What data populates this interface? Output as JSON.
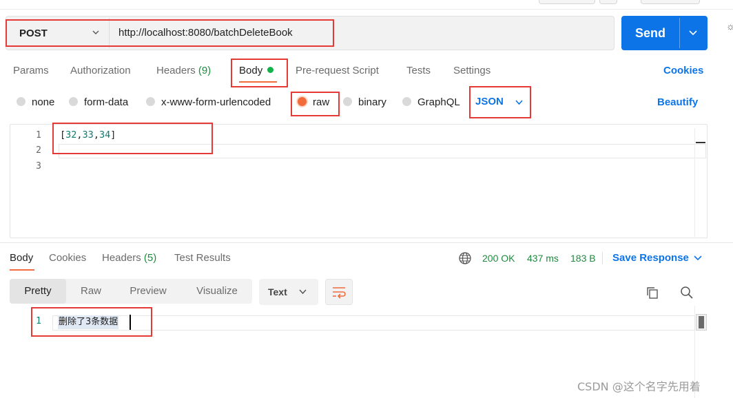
{
  "colors": {
    "accent": "#0d74e7",
    "active_underline": "#f26b3a",
    "highlight_box": "#e53935",
    "status_ok": "#1f8a3e"
  },
  "request": {
    "method": "POST",
    "url": "http://localhost:8080/batchDeleteBook",
    "send_label": "Send"
  },
  "request_tabs": [
    {
      "label": "Params"
    },
    {
      "label": "Authorization"
    },
    {
      "label": "Headers",
      "count": "(9)"
    },
    {
      "label": "Body"
    },
    {
      "label": "Pre-request Script"
    },
    {
      "label": "Tests"
    },
    {
      "label": "Settings"
    }
  ],
  "cookies_link": "Cookies",
  "body_types": [
    "none",
    "form-data",
    "x-www-form-urlencoded",
    "raw",
    "binary",
    "GraphQL"
  ],
  "body_format": "JSON",
  "beautify_label": "Beautify",
  "editor": {
    "line_numbers": [
      "1",
      "2",
      "3"
    ],
    "tokens": {
      "open": "[",
      "n1": "32",
      "c1": ",",
      "n2": "33",
      "c2": ",",
      "n3": "34",
      "close": "]"
    }
  },
  "response_tabs": [
    {
      "label": "Body"
    },
    {
      "label": "Cookies"
    },
    {
      "label": "Headers",
      "count": "(5)"
    },
    {
      "label": "Test Results"
    }
  ],
  "response_status": {
    "code": "200 OK",
    "time": "437 ms",
    "size": "183 B"
  },
  "save_response_label": "Save Response",
  "view_modes": [
    "Pretty",
    "Raw",
    "Preview",
    "Visualize"
  ],
  "text_format": "Text",
  "response_body": {
    "line_number": "1",
    "text": "删除了3条数据"
  },
  "watermark": "CSDN @这个名字先用着",
  "edge_glyph": "☼"
}
